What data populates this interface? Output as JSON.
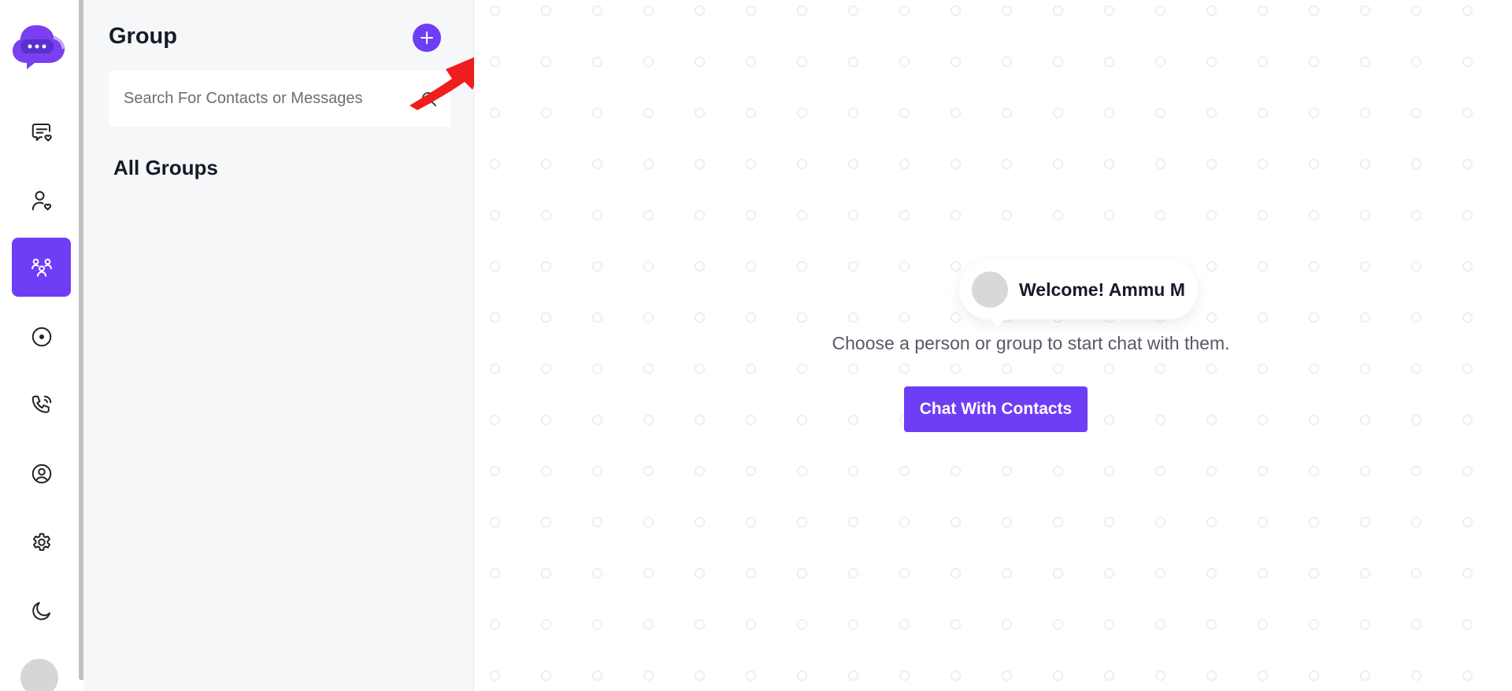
{
  "nav": {
    "items": [
      {
        "name": "chats",
        "icon": "chat-heart-icon"
      },
      {
        "name": "contacts",
        "icon": "user-heart-icon"
      },
      {
        "name": "groups",
        "icon": "group-icon",
        "active": true
      },
      {
        "name": "status",
        "icon": "status-circle-icon"
      },
      {
        "name": "calls",
        "icon": "phone-call-icon"
      },
      {
        "name": "profile",
        "icon": "user-circle-icon"
      },
      {
        "name": "settings",
        "icon": "gear-icon"
      },
      {
        "name": "theme",
        "icon": "moon-icon"
      }
    ],
    "accent_color": "#6d3ef5"
  },
  "panel": {
    "title": "Group",
    "search_placeholder": "Search For Contacts or Messages",
    "section_title": "All Groups"
  },
  "main": {
    "welcome": "Welcome! Ammu M",
    "subtitle": "Choose a person or group to start chat with them.",
    "cta_label": "Chat With Contacts"
  }
}
